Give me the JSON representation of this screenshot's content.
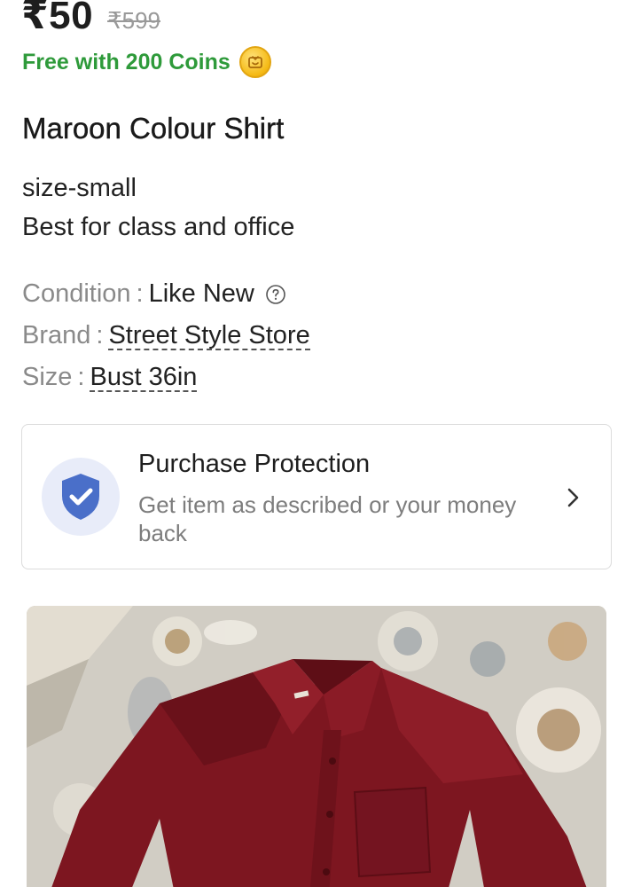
{
  "product": {
    "price": "₹50",
    "mrp": "₹599",
    "coins_text": "Free with 200 Coins",
    "title": "Maroon Colour Shirt",
    "description": [
      "size-small",
      "Best for class and office"
    ],
    "attributes": [
      {
        "key": "Condition",
        "value": "Like New"
      },
      {
        "key": "Brand",
        "value": "Street Style Store"
      },
      {
        "key": "Size",
        "value": "Bust 36in"
      }
    ]
  },
  "protection": {
    "title": "Purchase Protection",
    "subtitle": "Get item as described or your money back"
  },
  "colors": {
    "price": "#1e1e1e",
    "coins_green": "#2e9a3a",
    "shield_blue": "#4a6fc9",
    "shirt_maroon": "#7d1620"
  },
  "icons": {
    "coin": "coin-icon",
    "help": "question-circle-icon",
    "shield": "shield-check-icon",
    "chevron": "chevron-right-icon"
  }
}
